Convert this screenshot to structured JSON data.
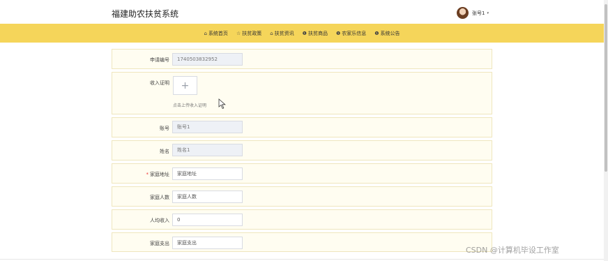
{
  "header": {
    "title": "福建助农扶贫系统",
    "username": "张号1",
    "caret": "▾",
    "avatar_icon": "user-avatar"
  },
  "nav": {
    "items": [
      {
        "icon": "home-icon",
        "glyph": "⌂",
        "label": "系统首页"
      },
      {
        "icon": "star-icon",
        "glyph": "☆",
        "label": "扶贫政策"
      },
      {
        "icon": "bag-icon",
        "glyph": "⌂",
        "label": "扶贫资讯"
      },
      {
        "icon": "info-icon",
        "glyph": "❶",
        "label": "扶贫商品"
      },
      {
        "icon": "info-icon",
        "glyph": "❶",
        "label": "农家乐信息"
      },
      {
        "icon": "info-icon",
        "glyph": "❶",
        "label": "系统公告"
      }
    ]
  },
  "form": {
    "application_no": {
      "label": "申请编号",
      "value": "1740503832952"
    },
    "income_proof": {
      "label": "收入证明",
      "plus": "+",
      "hint": "点击上传收入证明"
    },
    "account": {
      "label": "账号",
      "value": "账号1"
    },
    "name": {
      "label": "姓名",
      "value": "姓名1"
    },
    "address": {
      "label": "家庭地址",
      "required": "*",
      "placeholder": "家庭地址"
    },
    "household_size": {
      "label": "家庭人数",
      "placeholder": "家庭人数"
    },
    "per_capita_income": {
      "label": "人均收入",
      "value": "0"
    },
    "expenses": {
      "label": "家庭支出",
      "placeholder": "家庭支出"
    }
  },
  "watermark": "CSDN @计算机毕设工作室",
  "colors": {
    "nav_bg": "#f5d55a",
    "row_bg": "#fffdf1",
    "row_border": "#efe6bd",
    "required": "#e33333"
  }
}
